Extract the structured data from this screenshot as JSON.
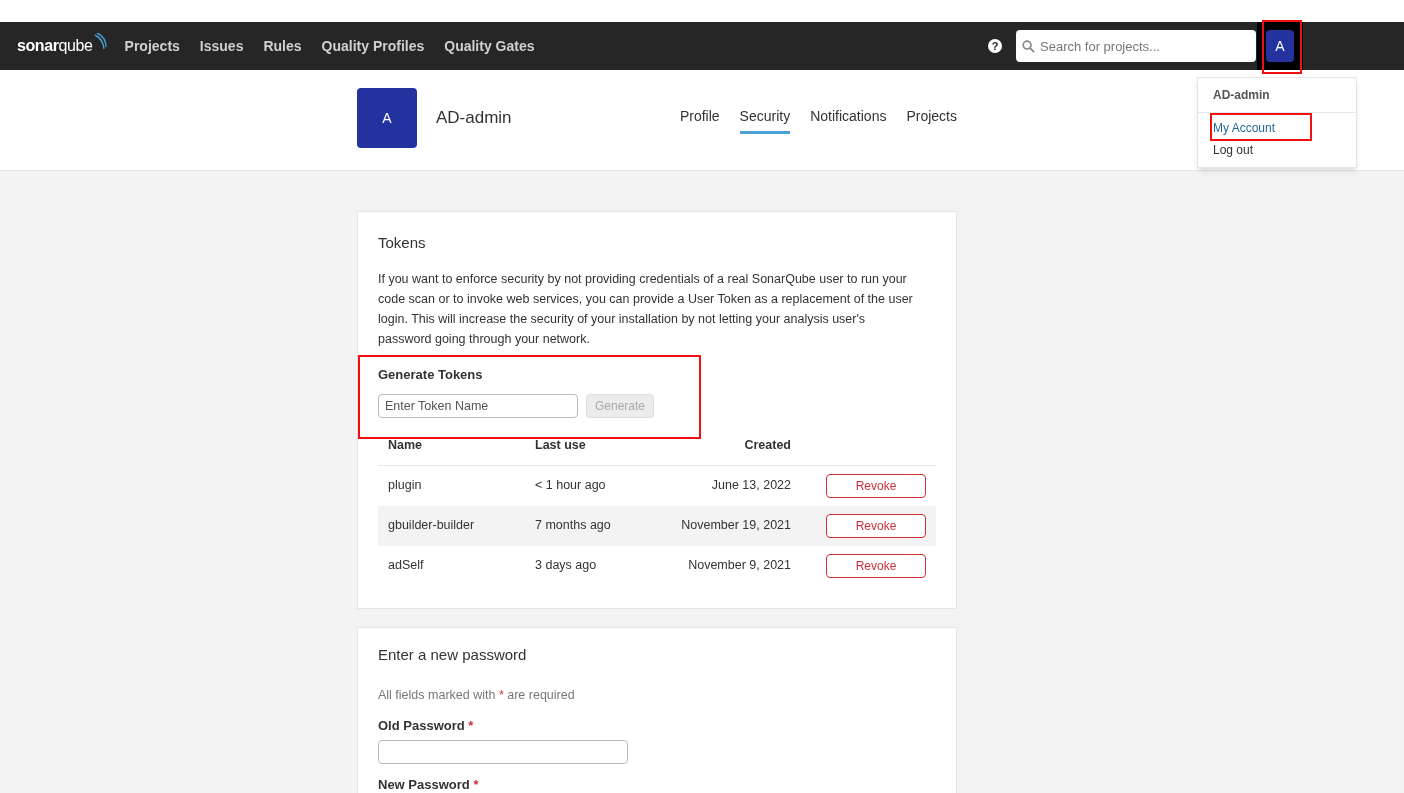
{
  "nav": {
    "logo": {
      "bold": "sonar",
      "light": "qube"
    },
    "links": [
      "Projects",
      "Issues",
      "Rules",
      "Quality Profiles",
      "Quality Gates"
    ],
    "help": "?",
    "search": {
      "placeholder": "Search for projects..."
    },
    "avatar": "A"
  },
  "menu": {
    "user": "AD-admin",
    "items": [
      {
        "label": "My Account",
        "selected": true
      },
      {
        "label": "Log out",
        "selected": false
      }
    ]
  },
  "header": {
    "avatar": "A",
    "name": "AD-admin",
    "tabs": [
      {
        "label": "Profile",
        "selected": false
      },
      {
        "label": "Security",
        "selected": true
      },
      {
        "label": "Notifications",
        "selected": false
      },
      {
        "label": "Projects",
        "selected": false
      }
    ]
  },
  "tokens": {
    "title": "Tokens",
    "description": "If you want to enforce security by not providing credentials of a real SonarQube user to run your code scan or to invoke web services, you can provide a User Token as a replacement of the user login. This will increase the security of your installation by not letting your analysis user's password going through your network.",
    "generate_title": "Generate Tokens",
    "field": {
      "placeholder": "Enter Token Name"
    },
    "generate": {
      "label": "Generate",
      "disabled": true
    },
    "columns": [
      "Name",
      "Last use",
      "Created"
    ],
    "rows": [
      {
        "name": "plugin",
        "last_use": "< 1 hour ago",
        "created": "June 13, 2022",
        "action": "Revoke"
      },
      {
        "name": "gbuilder-builder",
        "last_use": "7 months ago",
        "created": "November 19, 2021",
        "action": "Revoke"
      },
      {
        "name": "adSelf",
        "last_use": "3 days ago",
        "created": "November 9, 2021",
        "action": "Revoke"
      }
    ]
  },
  "password": {
    "title": "Enter a new password",
    "note_before": "All fields marked with",
    "note_mark": "*",
    "note_after": "are required",
    "fields": [
      {
        "label": "Old Password",
        "mark": "*"
      },
      {
        "label": "New Password",
        "mark": "*"
      }
    ]
  }
}
